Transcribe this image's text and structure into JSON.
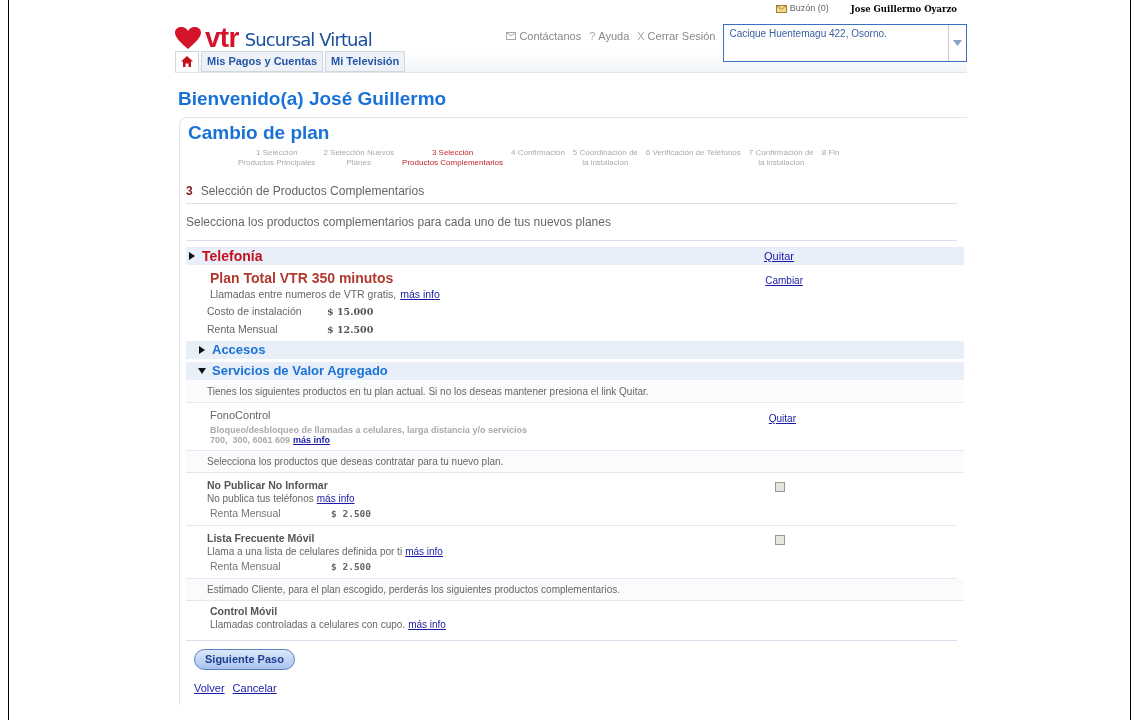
{
  "header": {
    "mailbox": "Buzón (0)",
    "user": "Jose Guillermo Oyarzo",
    "logo_mark": "vtr",
    "logo_text": "Sucursal Virtual",
    "nav_links": [
      {
        "kind": "mail",
        "label": "Contáctanos"
      },
      {
        "kind": "glyph",
        "glyph": "?",
        "label": "Ayuda"
      },
      {
        "kind": "glyph",
        "glyph": "X",
        "label": "Cerrar Sesión"
      }
    ],
    "address": "Cacique Huentemagu 422, Osorno."
  },
  "tabs": [
    {
      "kind": "home",
      "selected": true
    },
    {
      "kind": "text",
      "label": "Mis Pagos y Cuentas",
      "selected": false
    },
    {
      "kind": "text",
      "label": "Mi Televisión",
      "selected": false
    }
  ],
  "welcome": "Bienvenido(a) José Guillermo",
  "card_title": "Cambio de plan",
  "steps": [
    {
      "lines": [
        "1 Selección",
        "Productos Principales"
      ],
      "selected": false
    },
    {
      "lines": [
        "2 Selección Nuevos",
        "Planes"
      ],
      "selected": false
    },
    {
      "lines": [
        "3 Selección",
        "Productos Complementarios"
      ],
      "selected": true
    },
    {
      "lines": [
        "4 Confirmación"
      ],
      "selected": false
    },
    {
      "lines": [
        "5 Coordinación de",
        "la instalación"
      ],
      "selected": false
    },
    {
      "lines": [
        "6 Verificación de Teléfonos"
      ],
      "selected": false
    },
    {
      "lines": [
        "7 Confirmación de",
        "la instalación"
      ],
      "selected": false
    },
    {
      "lines": [
        "8 Fin"
      ],
      "selected": false
    }
  ],
  "section": {
    "number": "3",
    "title": "Selección de Productos Complementarios"
  },
  "intro": "Selecciona los productos complementarios para cada uno de tus nuevos planes",
  "group": {
    "title": "Telefonía",
    "expanded": false,
    "action": "Quitar",
    "plan": {
      "name": "Plan Total VTR 350 minutos",
      "description": "Llamadas entre numeros de VTR gratis,",
      "link": "más info",
      "action": "Cambiar",
      "costs": [
        {
          "label": "Costo de instalación",
          "value": "$ 15.000"
        },
        {
          "label": "Renta Mensual",
          "value": "$ 12.500"
        }
      ]
    },
    "subgroups": [
      {
        "title": "Accesos",
        "expanded": false
      },
      {
        "title": "Servicios de Valor Agregado",
        "expanded": true
      }
    ]
  },
  "notice_current": "Tienes los siguientes productos en tu plan actual. Si no los deseas mantener presiona el link Quitar.",
  "current_items": [
    {
      "name": "FonoControl",
      "lines": [
        "Bloqueo/desbloqueo de llamadas a celulares, larga distancia y/o servicios",
        "700,  300, 6061 609"
      ],
      "link": "más info",
      "action": "Quitar"
    }
  ],
  "notice_new": "Selecciona los productos que deseas contratar para tu nuevo plan.",
  "new_items": [
    {
      "name": "No Publicar No Informar",
      "description": "No publica tus teléfonos",
      "link": "más info",
      "price_label": "Renta Mensual",
      "price": "$ 2.500",
      "checked": false
    },
    {
      "name": "Lista Frecuente Móvil",
      "description": "Llama a una lista de celulares definida por ti",
      "link": "más info",
      "price_label": "Renta Mensual",
      "price": "$ 2.500",
      "checked": false
    }
  ],
  "notice_lost": "Estimado Cliente, para el plan escogido, perderás los siguientes productos complementarios.",
  "lost_items": [
    {
      "name": "Control Móvil",
      "description": "Llamadas controladas a celulares con cupo.",
      "link": "más info"
    }
  ],
  "next_button": "Siguiente Paso",
  "footer_links": [
    "Volver",
    "Cancelar"
  ]
}
